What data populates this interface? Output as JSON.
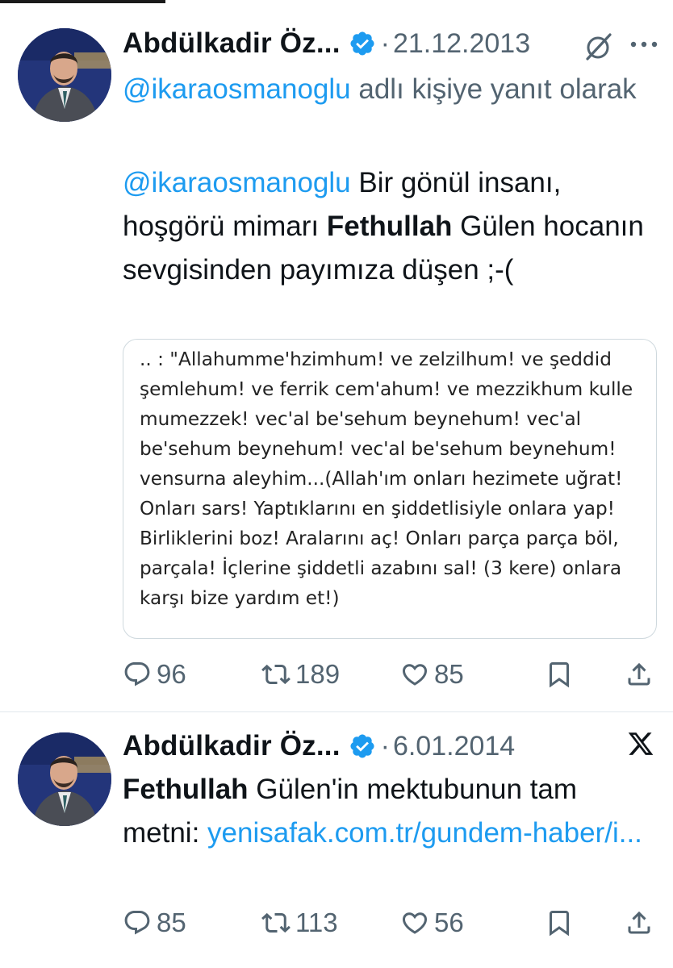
{
  "tweets": [
    {
      "author": "Abdülkadir Öz...",
      "separator": "·",
      "date": "21.12.2013",
      "reply_prefix_mention": "@ikaraosmanoglu",
      "reply_suffix": "adlı kişiye yanıt olarak",
      "body_mention": "@ikaraosmanoglu",
      "body_1": "Bir gönül insanı, hoşgörü mimarı",
      "body_bold": "Fethullah",
      "body_2": "Gülen hocanın sevgisinden payımıza düşen ;-(",
      "card_text": ".. :  \"Allahumme'hzimhum! ve zelzilhum! ve şeddid şemlehum! ve ferrik cem'ahum! ve mezzikhum kulle mumezzek! vec'al be'sehum beynehum! vec'al be'sehum beynehum! vec'al be'sehum beynehum! vensurna aleyhim...(Allah'ım onları hezimete uğrat! Onları sars! Yaptıklarını en şiddetlisiyle onlara yap! Birliklerini boz! Aralarını aç! Onları parça parça böl, parçala! İçlerine şiddetli azabını sal! (3 kere) onlara karşı bize yardım et!)",
      "replies": "96",
      "retweets": "189",
      "likes": "85"
    },
    {
      "author": "Abdülkadir Öz...",
      "separator": "·",
      "date": "6.01.2014",
      "body_bold": "Fethullah",
      "body_1": "Gülen'in mektubunun tam metni:",
      "link": "yenisafak.com.tr/gundem-haber/i...",
      "replies": "85",
      "retweets": "113",
      "likes": "56"
    }
  ],
  "icons": {
    "verified": "verified-badge-icon",
    "grok": "grok-icon",
    "more": "more-icon",
    "x_logo": "x-logo-icon",
    "reply": "reply-icon",
    "retweet": "retweet-icon",
    "like": "like-icon",
    "bookmark": "bookmark-icon",
    "share": "share-icon"
  },
  "colors": {
    "accent": "#1d9bf0",
    "secondary_text": "#536471",
    "text": "#0f1419"
  }
}
